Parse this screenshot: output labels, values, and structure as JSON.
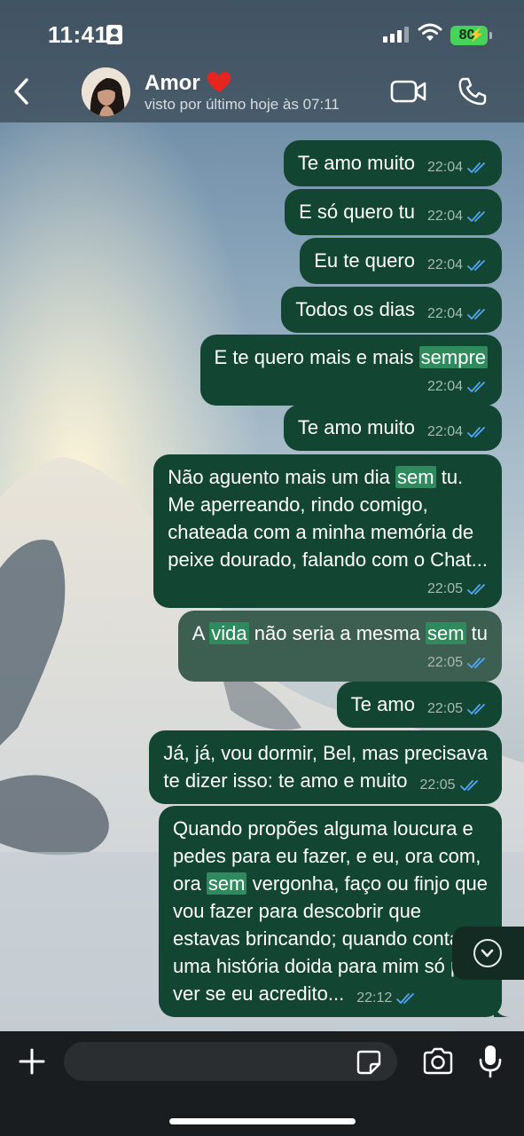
{
  "status_bar": {
    "time": "11:41",
    "battery": "80"
  },
  "header": {
    "contact_name": "Amor",
    "last_seen": "visto por último hoje às 07:11"
  },
  "messages": [
    {
      "segments": [
        {
          "t": "Te amo muito"
        }
      ],
      "time": "22:04"
    },
    {
      "segments": [
        {
          "t": "E só quero tu"
        }
      ],
      "time": "22:04"
    },
    {
      "segments": [
        {
          "t": "Eu te quero"
        }
      ],
      "time": "22:04"
    },
    {
      "segments": [
        {
          "t": "Todos os dias"
        }
      ],
      "time": "22:04"
    },
    {
      "segments": [
        {
          "t": "E te quero mais e mais "
        },
        {
          "t": "sempre",
          "hl": true
        }
      ],
      "time": "22:04"
    },
    {
      "segments": [
        {
          "t": "Te amo muito"
        }
      ],
      "time": "22:04"
    },
    {
      "segments": [
        {
          "t": "Não aguento mais um dia "
        },
        {
          "t": "sem",
          "hl": true
        },
        {
          "t": " tu.\nMe aperreando, rindo comigo,\nchateada com a minha memória de\npeixe dourado, falando com o Chat..."
        }
      ],
      "time": "22:05"
    },
    {
      "segments": [
        {
          "t": "A "
        },
        {
          "t": "vida",
          "hl": true
        },
        {
          "t": " não seria a mesma "
        },
        {
          "t": "sem",
          "hl": true
        },
        {
          "t": " tu"
        }
      ],
      "time": "22:05",
      "selected": true
    },
    {
      "segments": [
        {
          "t": "Te amo"
        }
      ],
      "time": "22:05"
    },
    {
      "segments": [
        {
          "t": "Já, já, vou dormir, Bel, mas precisava\nte dizer isso: te amo e muito"
        }
      ],
      "time": "22:05"
    },
    {
      "segments": [
        {
          "t": "Quando propões alguma loucura e\npedes para eu fazer, e eu, ora com,\nora "
        },
        {
          "t": "sem",
          "hl": true
        },
        {
          "t": " vergonha, faço ou finjo que\nvou fazer para descobrir que\nestavas brincando; quando contas\numa história doida para mim só pra\nver se eu acredito..."
        }
      ],
      "time": "22:12"
    }
  ],
  "input": {
    "placeholder": ""
  },
  "colors": {
    "bubble_sent": "#124632",
    "bubble_selected": "#3c5f52",
    "highlight": "#2f8a5e",
    "read_ticks": "#53a6f5"
  }
}
